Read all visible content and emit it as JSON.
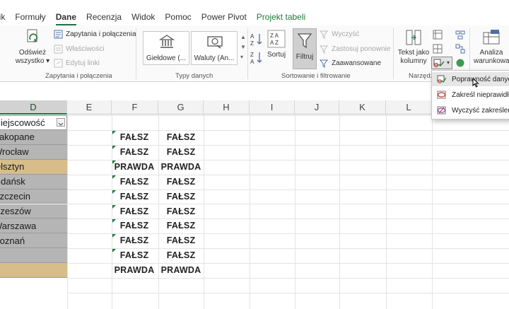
{
  "tabs": [
    {
      "label": "Plik",
      "active": false
    },
    {
      "label": "Formuły",
      "active": false
    },
    {
      "label": "Dane",
      "active": true
    },
    {
      "label": "Recenzja",
      "active": false
    },
    {
      "label": "Widok",
      "active": false
    },
    {
      "label": "Pomoc",
      "active": false
    },
    {
      "label": "Power Pivot",
      "active": false
    },
    {
      "label": "Projekt tabeli",
      "active": false
    }
  ],
  "ribbon": {
    "queries_group": {
      "refresh_line1": "Odśwież",
      "refresh_line2": "wszystko",
      "queries_label": "Zapytania i połączenia",
      "properties_label": "Właściwości",
      "edit_links_label": "Edytuj linki",
      "group_label": "Zapytania i połączenia"
    },
    "data_types_group": {
      "stocks_label": "Giełdowe (...",
      "currencies_label": "Waluty (An...",
      "group_label": "Typy danych"
    },
    "sort_filter_group": {
      "sort_label": "Sortuj",
      "filter_label": "Filtruj",
      "clear_label": "Wyczyść",
      "reapply_label": "Zastosuj ponownie",
      "advanced_label": "Zaawansowane",
      "group_label": "Sortowanie i filtrowanie"
    },
    "data_tools_group": {
      "text_to_columns_line1": "Tekst jako",
      "text_to_columns_line2": "kolumny",
      "group_label": "Narzędzia"
    },
    "forecast_group": {
      "whatif_line1": "Analiza",
      "whatif_line2": "warunkowa"
    }
  },
  "dropdown": {
    "items": [
      "Poprawność danych...",
      "Zakreśl nieprawidłowe dane",
      "Wyczyść zakreślenia"
    ]
  },
  "columns": [
    "D",
    "E",
    "F",
    "G",
    "H",
    "I",
    "J",
    "K",
    "L"
  ],
  "selected_column": "D",
  "table": {
    "header": "Miejscowość",
    "rows": [
      {
        "city": "Zakopane",
        "f": "FAŁSZ",
        "g": "FAŁSZ",
        "highlight": false,
        "flag": true
      },
      {
        "city": "Wrocław",
        "f": "FAŁSZ",
        "g": "FAŁSZ",
        "highlight": false,
        "flag": true
      },
      {
        "city": "Olsztyn",
        "f": "PRAWDA",
        "g": "PRAWDA",
        "highlight": true,
        "flag": true
      },
      {
        "city": "Gdańsk",
        "f": "FAŁSZ",
        "g": "FAŁSZ",
        "highlight": false,
        "flag": true
      },
      {
        "city": "Szczecin",
        "f": "FAŁSZ",
        "g": "FAŁSZ",
        "highlight": false,
        "flag": true
      },
      {
        "city": "Rzeszów",
        "f": "FAŁSZ",
        "g": "FAŁSZ",
        "highlight": false,
        "flag": true
      },
      {
        "city": "Warszawa",
        "f": "FAŁSZ",
        "g": "FAŁSZ",
        "highlight": false,
        "flag": true
      },
      {
        "city": "Poznań",
        "f": "FAŁSZ",
        "g": "FAŁSZ",
        "highlight": false,
        "flag": true
      },
      {
        "city": "",
        "f": "FAŁSZ",
        "g": "FAŁSZ",
        "highlight": false,
        "flag": true
      },
      {
        "city": "",
        "f": "PRAWDA",
        "g": "PRAWDA",
        "highlight": true,
        "flag": false
      }
    ]
  },
  "colors": {
    "accent": "#217346",
    "highlight_fill": "#d6bd8a",
    "table_fill": "#b5b5b5"
  }
}
